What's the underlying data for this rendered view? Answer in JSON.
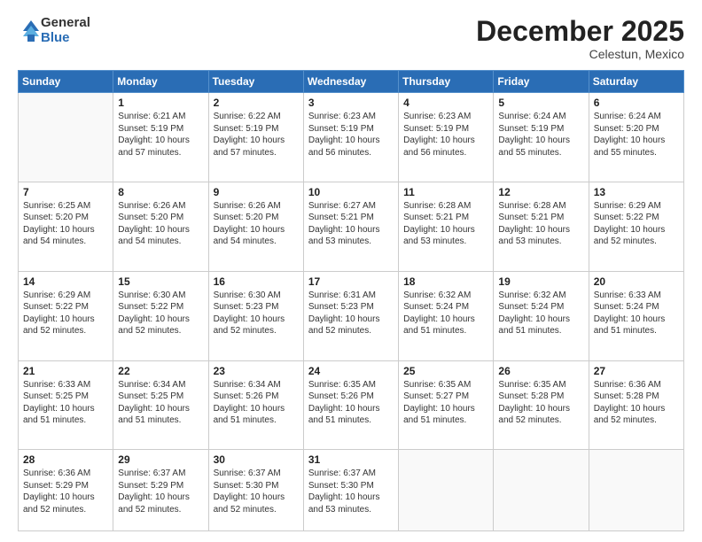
{
  "logo": {
    "general": "General",
    "blue": "Blue"
  },
  "header": {
    "month": "December 2025",
    "location": "Celestun, Mexico"
  },
  "weekdays": [
    "Sunday",
    "Monday",
    "Tuesday",
    "Wednesday",
    "Thursday",
    "Friday",
    "Saturday"
  ],
  "weeks": [
    [
      {
        "day": "",
        "info": ""
      },
      {
        "day": "1",
        "info": "Sunrise: 6:21 AM\nSunset: 5:19 PM\nDaylight: 10 hours\nand 57 minutes."
      },
      {
        "day": "2",
        "info": "Sunrise: 6:22 AM\nSunset: 5:19 PM\nDaylight: 10 hours\nand 57 minutes."
      },
      {
        "day": "3",
        "info": "Sunrise: 6:23 AM\nSunset: 5:19 PM\nDaylight: 10 hours\nand 56 minutes."
      },
      {
        "day": "4",
        "info": "Sunrise: 6:23 AM\nSunset: 5:19 PM\nDaylight: 10 hours\nand 56 minutes."
      },
      {
        "day": "5",
        "info": "Sunrise: 6:24 AM\nSunset: 5:19 PM\nDaylight: 10 hours\nand 55 minutes."
      },
      {
        "day": "6",
        "info": "Sunrise: 6:24 AM\nSunset: 5:20 PM\nDaylight: 10 hours\nand 55 minutes."
      }
    ],
    [
      {
        "day": "7",
        "info": "Sunrise: 6:25 AM\nSunset: 5:20 PM\nDaylight: 10 hours\nand 54 minutes."
      },
      {
        "day": "8",
        "info": "Sunrise: 6:26 AM\nSunset: 5:20 PM\nDaylight: 10 hours\nand 54 minutes."
      },
      {
        "day": "9",
        "info": "Sunrise: 6:26 AM\nSunset: 5:20 PM\nDaylight: 10 hours\nand 54 minutes."
      },
      {
        "day": "10",
        "info": "Sunrise: 6:27 AM\nSunset: 5:21 PM\nDaylight: 10 hours\nand 53 minutes."
      },
      {
        "day": "11",
        "info": "Sunrise: 6:28 AM\nSunset: 5:21 PM\nDaylight: 10 hours\nand 53 minutes."
      },
      {
        "day": "12",
        "info": "Sunrise: 6:28 AM\nSunset: 5:21 PM\nDaylight: 10 hours\nand 53 minutes."
      },
      {
        "day": "13",
        "info": "Sunrise: 6:29 AM\nSunset: 5:22 PM\nDaylight: 10 hours\nand 52 minutes."
      }
    ],
    [
      {
        "day": "14",
        "info": "Sunrise: 6:29 AM\nSunset: 5:22 PM\nDaylight: 10 hours\nand 52 minutes."
      },
      {
        "day": "15",
        "info": "Sunrise: 6:30 AM\nSunset: 5:22 PM\nDaylight: 10 hours\nand 52 minutes."
      },
      {
        "day": "16",
        "info": "Sunrise: 6:30 AM\nSunset: 5:23 PM\nDaylight: 10 hours\nand 52 minutes."
      },
      {
        "day": "17",
        "info": "Sunrise: 6:31 AM\nSunset: 5:23 PM\nDaylight: 10 hours\nand 52 minutes."
      },
      {
        "day": "18",
        "info": "Sunrise: 6:32 AM\nSunset: 5:24 PM\nDaylight: 10 hours\nand 51 minutes."
      },
      {
        "day": "19",
        "info": "Sunrise: 6:32 AM\nSunset: 5:24 PM\nDaylight: 10 hours\nand 51 minutes."
      },
      {
        "day": "20",
        "info": "Sunrise: 6:33 AM\nSunset: 5:24 PM\nDaylight: 10 hours\nand 51 minutes."
      }
    ],
    [
      {
        "day": "21",
        "info": "Sunrise: 6:33 AM\nSunset: 5:25 PM\nDaylight: 10 hours\nand 51 minutes."
      },
      {
        "day": "22",
        "info": "Sunrise: 6:34 AM\nSunset: 5:25 PM\nDaylight: 10 hours\nand 51 minutes."
      },
      {
        "day": "23",
        "info": "Sunrise: 6:34 AM\nSunset: 5:26 PM\nDaylight: 10 hours\nand 51 minutes."
      },
      {
        "day": "24",
        "info": "Sunrise: 6:35 AM\nSunset: 5:26 PM\nDaylight: 10 hours\nand 51 minutes."
      },
      {
        "day": "25",
        "info": "Sunrise: 6:35 AM\nSunset: 5:27 PM\nDaylight: 10 hours\nand 51 minutes."
      },
      {
        "day": "26",
        "info": "Sunrise: 6:35 AM\nSunset: 5:28 PM\nDaylight: 10 hours\nand 52 minutes."
      },
      {
        "day": "27",
        "info": "Sunrise: 6:36 AM\nSunset: 5:28 PM\nDaylight: 10 hours\nand 52 minutes."
      }
    ],
    [
      {
        "day": "28",
        "info": "Sunrise: 6:36 AM\nSunset: 5:29 PM\nDaylight: 10 hours\nand 52 minutes."
      },
      {
        "day": "29",
        "info": "Sunrise: 6:37 AM\nSunset: 5:29 PM\nDaylight: 10 hours\nand 52 minutes."
      },
      {
        "day": "30",
        "info": "Sunrise: 6:37 AM\nSunset: 5:30 PM\nDaylight: 10 hours\nand 52 minutes."
      },
      {
        "day": "31",
        "info": "Sunrise: 6:37 AM\nSunset: 5:30 PM\nDaylight: 10 hours\nand 53 minutes."
      },
      {
        "day": "",
        "info": ""
      },
      {
        "day": "",
        "info": ""
      },
      {
        "day": "",
        "info": ""
      }
    ]
  ]
}
